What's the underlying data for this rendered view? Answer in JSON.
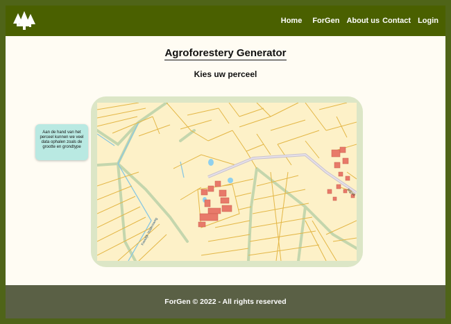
{
  "brand": {
    "logo_icon": "trees-icon"
  },
  "nav": {
    "items": [
      {
        "label": "Home"
      },
      {
        "label": "ForGen"
      },
      {
        "label": "About us"
      },
      {
        "label": "Contact"
      },
      {
        "label": "Login"
      }
    ]
  },
  "main": {
    "title": "Agroforestery Generator",
    "subtitle": "Kies uw perceel",
    "tooltip": "Aan de hand van het perceel kunnen we veel data ophalen zoals de grootte en grondtype"
  },
  "map": {
    "street_labels": [
      "Kwadijk Voldersweg",
      "Rijpstr"
    ]
  },
  "footer": {
    "text": "ForGen © 2022 - All rights reserved"
  },
  "colors": {
    "page_border": "#4f6418",
    "navbar": "#4a6000",
    "background": "#fffcf3",
    "map_frame": "#dce6c6",
    "parcel_fill": "#fdf1c8",
    "parcel_line": "#e3b645",
    "water": "#6ab6d8",
    "building": "#e87a6a",
    "footer": "#5a6045",
    "tooltip": "#b9e9e2"
  }
}
